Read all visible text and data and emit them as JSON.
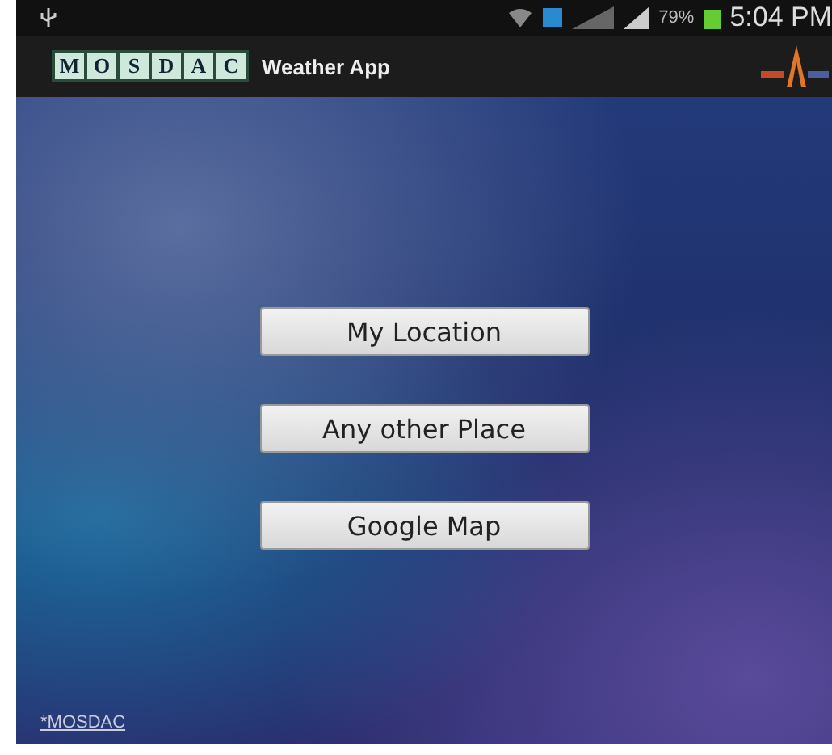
{
  "status_bar": {
    "battery": "79%",
    "time": "5:04 PM"
  },
  "app_bar": {
    "logo_letters": [
      "M",
      "O",
      "S",
      "D",
      "A",
      "C"
    ],
    "title": "Weather App"
  },
  "buttons": [
    "My Location",
    "Any other Place",
    "Google Map"
  ],
  "footer_link": "*MOSDAC"
}
